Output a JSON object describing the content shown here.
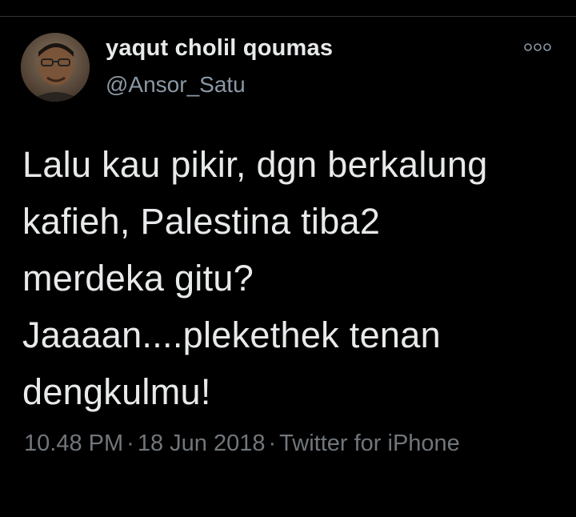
{
  "author": {
    "name": "yaqut cholil qoumas",
    "handle": "@Ansor_Satu",
    "avatar_icon": "profile-photo"
  },
  "more_icon": "ellipsis-icon",
  "tweet": {
    "text": "Lalu kau pikir, dgn berkalung\nkafieh, Palestina tiba2\nmerdeka gitu?\nJaaaan....plekethek tenan\ndengkulmu!"
  },
  "meta": {
    "time": "10.48 PM",
    "separator": "·",
    "date": "18 Jun 2018",
    "source": "Twitter for iPhone"
  },
  "colors": {
    "background": "#000000",
    "primary_text": "#e7e9ea",
    "secondary_text": "#71767b"
  }
}
